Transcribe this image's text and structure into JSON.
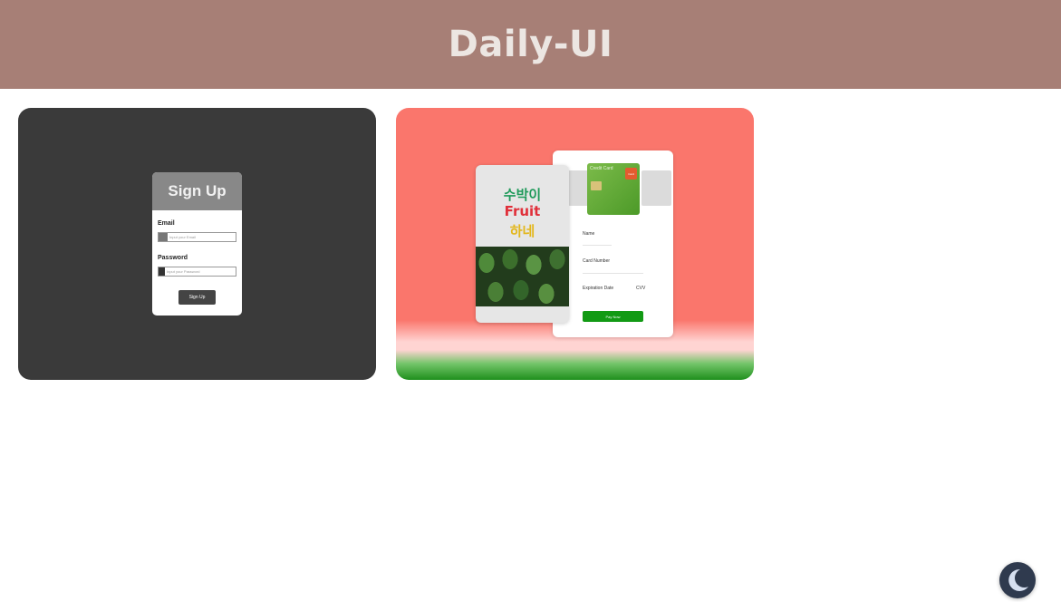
{
  "header": {
    "title": "Daily-UI"
  },
  "cards": [
    {
      "kind": "signup",
      "form": {
        "title": "Sign Up",
        "email_label": "Email",
        "email_placeholder": "Input your Email",
        "password_label": "Password",
        "password_placeholder": "Input your Password",
        "button": "Sign Up"
      }
    },
    {
      "kind": "payment",
      "fruit": {
        "line1": "수박이",
        "line2": "Fruit",
        "line3": "하네"
      },
      "credit_card": {
        "title": "Credit Card",
        "logo": "Card"
      },
      "fields": {
        "name": "Name",
        "card_number": "Card Number",
        "expiration": "Expiration Date",
        "cvv": "CVV"
      },
      "button": "Pay Now"
    }
  ],
  "theme_toggle": {
    "icon": "moon-icon"
  },
  "colors": {
    "header": "#a77f76",
    "dark_card": "#3a3a3a",
    "melon_card": "#fa766c",
    "pay_button": "#129a14",
    "toggle": "#2f3a4e"
  }
}
